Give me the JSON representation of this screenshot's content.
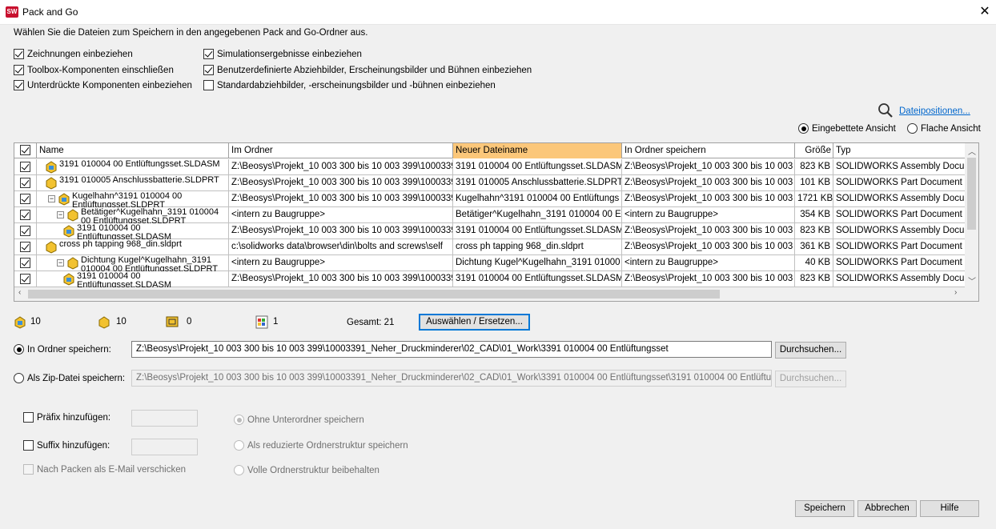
{
  "window": {
    "title": "Pack and Go",
    "app_icon": "SW"
  },
  "instruction": "Wählen Sie die Dateien zum Speichern in den angegebenen Pack and Go-Ordner aus.",
  "options_left": [
    {
      "label": "Zeichnungen einbeziehen",
      "checked": true
    },
    {
      "label": "Toolbox-Komponenten einschließen",
      "checked": true
    },
    {
      "label": "Unterdrückte Komponenten einbeziehen",
      "checked": true
    }
  ],
  "options_right": [
    {
      "label": "Simulationsergebnisse einbeziehen",
      "checked": true
    },
    {
      "label": "Benutzerdefinierte Abziehbilder, Erscheinungsbilder und Bühnen einbeziehen",
      "checked": true
    },
    {
      "label": "Standardabziehbilder, -erscheinungsbilder und -bühnen einbeziehen",
      "checked": false
    }
  ],
  "file_locations_link": "Dateipositionen...",
  "view": {
    "embedded": "Eingebettete Ansicht",
    "flat": "Flache Ansicht",
    "selected": "embedded"
  },
  "columns": {
    "name": "Name",
    "folder": "Im Ordner",
    "newname": "Neuer Dateiname",
    "saveto": "In Ordner speichern",
    "size": "Größe",
    "type": "Typ"
  },
  "rows": [
    {
      "name": "3191 010004 00 Entlüftungsset.SLDASM",
      "name2": "",
      "folder": "Z:\\Beosys\\Projekt_10 003 300 bis 10 003 399\\10003391",
      "newname": "3191 010004 00 Entlüftungsset.SLDASM",
      "saveto": "Z:\\Beosys\\Projekt_10 003 300 bis 10 003 3",
      "size": "823 KB",
      "type": "SOLIDWORKS Assembly Document"
    },
    {
      "name": "3191 010005 Anschlussbatterie.SLDPRT",
      "name2": "",
      "folder": "Z:\\Beosys\\Projekt_10 003 300 bis 10 003 399\\10003391",
      "newname": "3191 010005 Anschlussbatterie.SLDPRT",
      "saveto": "Z:\\Beosys\\Projekt_10 003 300 bis 10 003 3",
      "size": "101 KB",
      "type": "SOLIDWORKS Part Document"
    },
    {
      "name": "Kugelhahn^3191 010004 00",
      "name2": "Entlüftungsset.SLDPRT",
      "folder": "Z:\\Beosys\\Projekt_10 003 300 bis 10 003 399\\10003391",
      "newname": "Kugelhahn^3191 010004 00 Entlüftungs",
      "saveto": "Z:\\Beosys\\Projekt_10 003 300 bis 10 003 3",
      "size": "1721 KB",
      "type": "SOLIDWORKS Assembly Document"
    },
    {
      "name": "Betätiger^Kugelhahn_3191 010004",
      "name2": "00 Entlüftungsset.SLDPRT",
      "folder": "<intern zu Baugruppe>",
      "newname": "Betätiger^Kugelhahn_3191 010004 00 E",
      "saveto": "<intern zu Baugruppe>",
      "size": "354 KB",
      "type": "SOLIDWORKS Part Document"
    },
    {
      "name": "3191 010004 00",
      "name2": "Entlüftungsset.SLDASM",
      "folder": "Z:\\Beosys\\Projekt_10 003 300 bis 10 003 399\\10003391",
      "newname": "3191 010004 00 Entlüftungsset.SLDASM",
      "saveto": "Z:\\Beosys\\Projekt_10 003 300 bis 10 003 3",
      "size": "823 KB",
      "type": "SOLIDWORKS Assembly Document"
    },
    {
      "name": "cross ph tapping 968_din.sldprt",
      "name2": "",
      "folder": "c:\\solidworks data\\browser\\din\\bolts and screws\\self",
      "newname": "cross ph tapping 968_din.sldprt",
      "saveto": "Z:\\Beosys\\Projekt_10 003 300 bis 10 003 3",
      "size": "361 KB",
      "type": "SOLIDWORKS Part Document"
    },
    {
      "name": "Dichtung Kugel^Kugelhahn_3191",
      "name2": "010004 00 Entlüftungsset.SLDPRT",
      "folder": "<intern zu Baugruppe>",
      "newname": "Dichtung Kugel^Kugelhahn_3191 01000",
      "saveto": "<intern zu Baugruppe>",
      "size": "40 KB",
      "type": "SOLIDWORKS Part Document"
    },
    {
      "name": "3191 010004 00",
      "name2": "Entlüftungsset.SLDASM",
      "folder": "Z:\\Beosys\\Projekt_10 003 300 bis 10 003 399\\10003391",
      "newname": "3191 010004 00 Entlüftungsset.SLDASM",
      "saveto": "Z:\\Beosys\\Projekt_10 003 300 bis 10 003 3",
      "size": "823 KB",
      "type": "SOLIDWORKS Assembly Document"
    }
  ],
  "counts": {
    "assemblies": "10",
    "parts": "10",
    "drawings": "0",
    "other": "1",
    "total": "Gesamt: 21"
  },
  "select_replace": "Auswählen / Ersetzen...",
  "save_folder": {
    "label": "In Ordner speichern:",
    "value": "Z:\\Beosys\\Projekt_10 003 300 bis 10 003 399\\10003391_Neher_Druckminderer\\02_CAD\\01_Work\\3391 010004 00 Entlüftungsset",
    "browse": "Durchsuchen..."
  },
  "save_zip": {
    "label": "Als Zip-Datei speichern:",
    "value": "Z:\\Beosys\\Projekt_10 003 300 bis 10 003 399\\10003391_Neher_Druckminderer\\02_CAD\\01_Work\\3391 010004 00 Entlüftungsset\\3191 010004 00 Entlüftungs:",
    "browse": "Durchsuchen..."
  },
  "prefix": {
    "label": "Präfix hinzufügen:"
  },
  "suffix": {
    "label": "Suffix hinzufügen:"
  },
  "email": {
    "label": "Nach Packen als E-Mail verschicken"
  },
  "structure": {
    "flat": "Ohne Unterordner speichern",
    "reduced": "Als reduzierte Ordnerstruktur speichern",
    "full": "Volle Ordnerstruktur beibehalten"
  },
  "buttons": {
    "save": "Speichern",
    "cancel": "Abbrechen",
    "help": "Hilfe"
  }
}
